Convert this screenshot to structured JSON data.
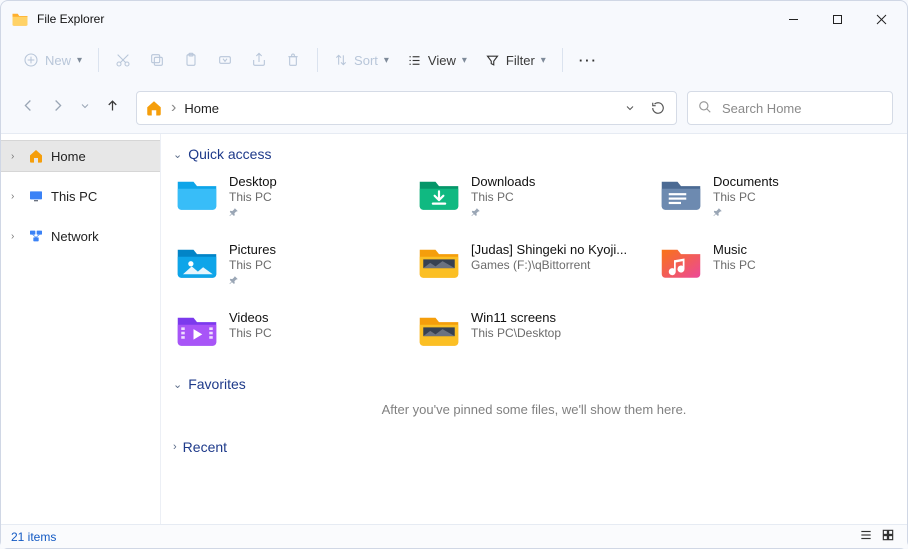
{
  "window": {
    "title": "File Explorer"
  },
  "toolbar": {
    "new": "New",
    "sort": "Sort",
    "view": "View",
    "filter": "Filter"
  },
  "breadcrumb": {
    "location": "Home"
  },
  "search": {
    "placeholder": "Search Home"
  },
  "sidebar": {
    "items": [
      {
        "label": "Home"
      },
      {
        "label": "This PC"
      },
      {
        "label": "Network"
      }
    ]
  },
  "sections": {
    "quick_access": {
      "title": "Quick access",
      "items": [
        {
          "name": "Desktop",
          "location": "This PC",
          "pinned": true,
          "icon": "desktop"
        },
        {
          "name": "Downloads",
          "location": "This PC",
          "pinned": true,
          "icon": "downloads"
        },
        {
          "name": "Documents",
          "location": "This PC",
          "pinned": true,
          "icon": "documents"
        },
        {
          "name": "Pictures",
          "location": "This PC",
          "pinned": true,
          "icon": "pictures"
        },
        {
          "name": "[Judas] Shingeki no Kyoji...",
          "location": "Games (F:)\\qBittorrent",
          "pinned": false,
          "icon": "folder-thumb"
        },
        {
          "name": "Music",
          "location": "This PC",
          "pinned": false,
          "icon": "music"
        },
        {
          "name": "Videos",
          "location": "This PC",
          "pinned": false,
          "icon": "videos"
        },
        {
          "name": "Win11 screens",
          "location": "This PC\\Desktop",
          "pinned": false,
          "icon": "folder-thumb"
        }
      ]
    },
    "favorites": {
      "title": "Favorites",
      "empty_hint": "After you've pinned some files, we'll show them here."
    },
    "recent": {
      "title": "Recent"
    }
  },
  "status": {
    "count_label": "21 items"
  }
}
